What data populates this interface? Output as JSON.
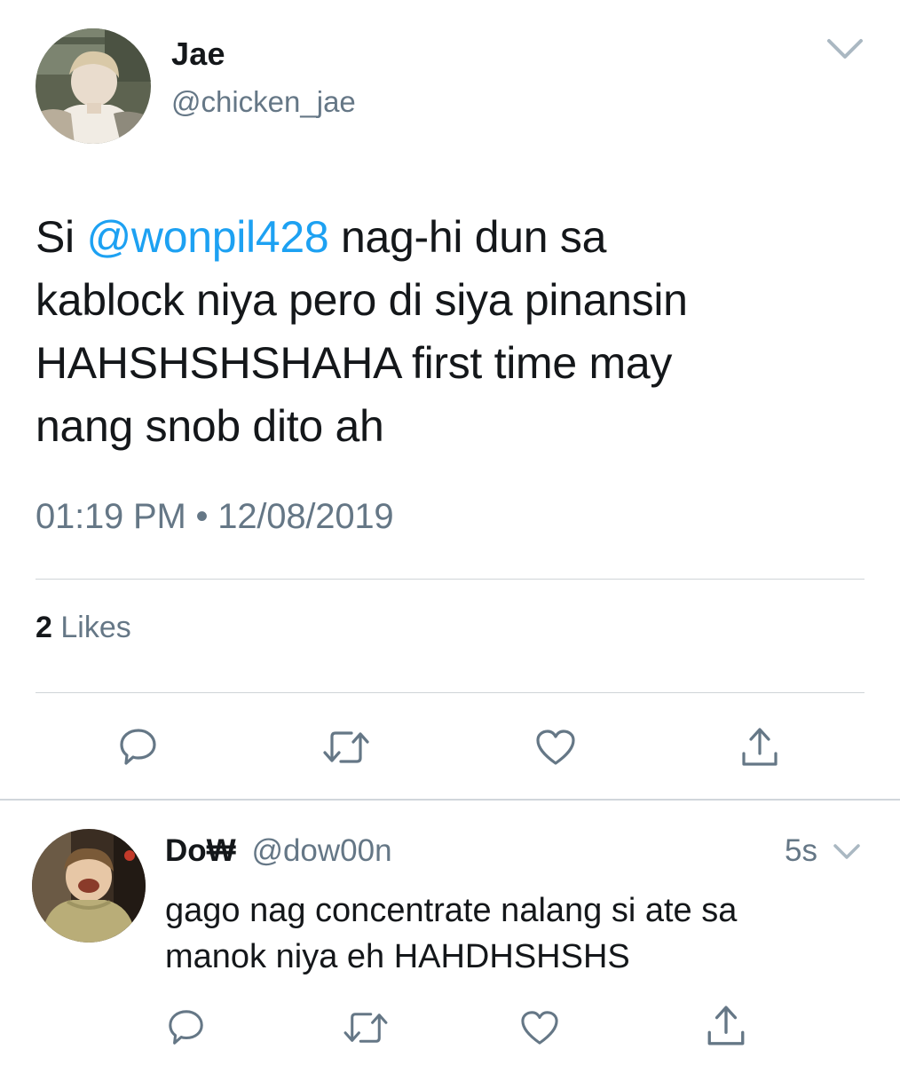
{
  "tweet": {
    "author_name": "Jae",
    "author_handle": "@chicken_jae",
    "text_lines": [
      {
        "prefix": "Si ",
        "mention": "@wonpil428",
        "suffix": " nag-hi dun sa"
      },
      "kablock niya pero di siya pinansin",
      "HAHSHSHSHAHA first time may",
      "nang snob dito ah"
    ],
    "time": "01:19 PM",
    "separator": "•",
    "date": "12/08/2019",
    "likes_count": "2",
    "likes_label": "Likes",
    "menu_icon": "chevron-down-icon",
    "actions": [
      "reply-icon",
      "retweet-icon",
      "like-icon",
      "share-icon"
    ]
  },
  "reply": {
    "author_name": "Do₩",
    "author_handle": "@dow00n",
    "time_ago": "5s",
    "text_lines": [
      "gago nag concentrate nalang si ate sa",
      "manok niya eh HAHDHSHSHS"
    ],
    "actions": [
      "reply-icon",
      "retweet-icon",
      "like-icon",
      "share-icon"
    ]
  },
  "colors": {
    "text": "#14171a",
    "secondary": "#657786",
    "link": "#1da1f2",
    "divider": "#cfd4d8"
  }
}
